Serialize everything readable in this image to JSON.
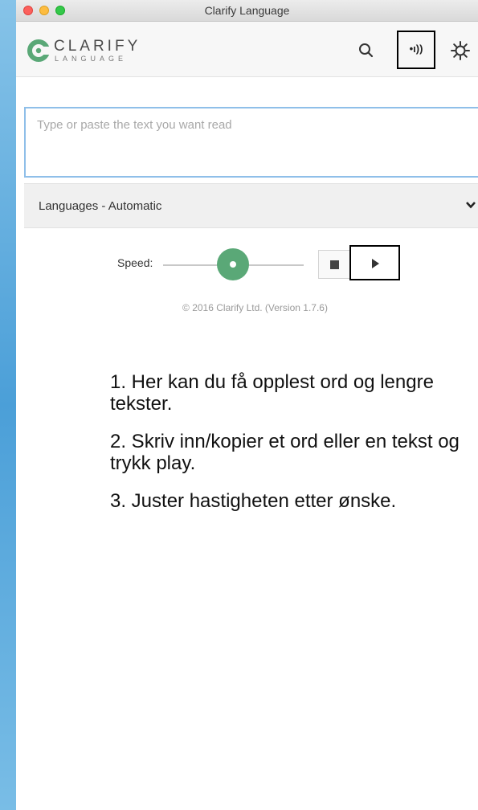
{
  "window": {
    "title": "Clarify Language"
  },
  "header": {
    "logo_text": "CLARIFY",
    "logo_subtext": "LANGUAGE",
    "speak_glyph": "•ı))"
  },
  "input": {
    "placeholder": "Type or paste the text you want read",
    "value": ""
  },
  "language_select": {
    "selected": "Languages - Automatic"
  },
  "controls": {
    "speed_label": "Speed:",
    "speed_value": 0.5
  },
  "footer": {
    "copyright": "© 2016 Clarify Ltd. (Version 1.7.6)"
  },
  "instructions": [
    "1. Her kan du få opplest ord og lengre tekster.",
    "2. Skriv inn/kopier et ord eller en tekst og trykk play.",
    "3. Juster hastigheten etter ønske."
  ],
  "colors": {
    "brand_green": "#5aa877",
    "input_border": "#8fbfe9",
    "highlight_box": "#000000"
  },
  "icons": [
    "logo-icon",
    "search-icon",
    "speaker-icon",
    "settings-gear-icon",
    "chevron-down-icon",
    "stop-icon",
    "play-icon"
  ]
}
